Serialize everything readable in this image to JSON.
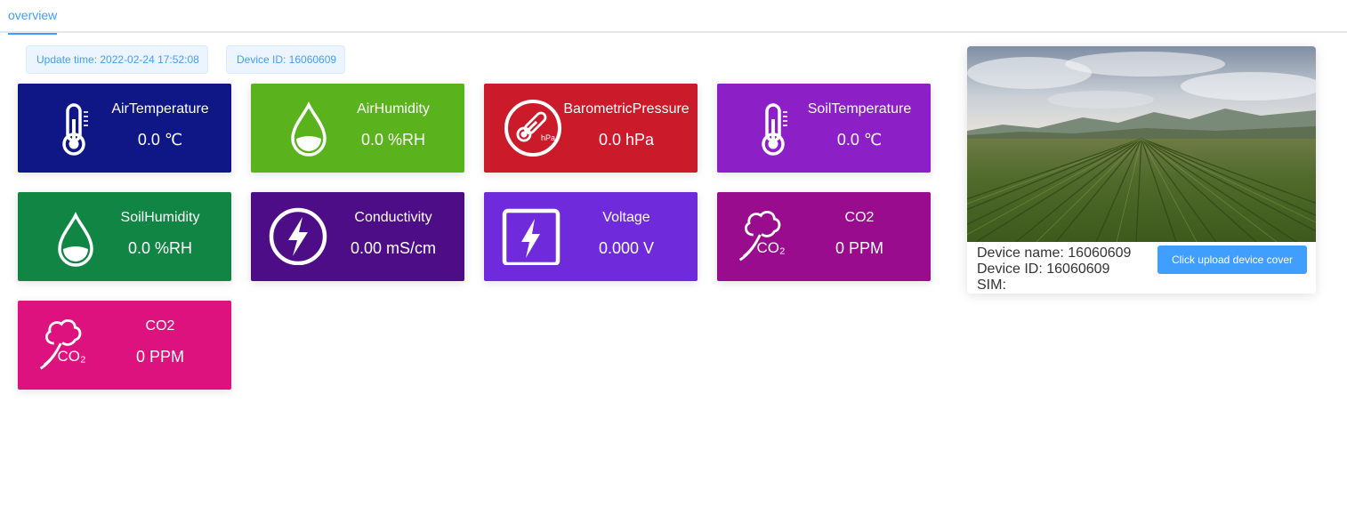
{
  "tabs": {
    "active_label": "overview"
  },
  "header": {
    "update_time": "Update time: 2022-02-24 17:52:08",
    "device_id": "Device ID: 16060609"
  },
  "sensors": [
    {
      "title": "AirTemperature",
      "value": "0.0 ℃",
      "icon": "thermometer-icon",
      "color": "#0f1787"
    },
    {
      "title": "AirHumidity",
      "value": "0.0 %RH",
      "icon": "water-drop-icon",
      "color": "#5ab31c"
    },
    {
      "title": "BarometricPressure",
      "value": "0.0 hPa",
      "icon": "barometer-icon",
      "color": "#cb1b2a",
      "icon_text": "hPa"
    },
    {
      "title": "SoilTemperature",
      "value": "0.0 ℃",
      "icon": "thermometer-icon",
      "color": "#8c1fc6"
    },
    {
      "title": "SoilHumidity",
      "value": "0.0 %RH",
      "icon": "water-drop-icon",
      "color": "#118644"
    },
    {
      "title": "Conductivity",
      "value": "0.00 mS/cm",
      "icon": "lightning-circle-icon",
      "color": "#4d0d86"
    },
    {
      "title": "Voltage",
      "value": "0.000 V",
      "icon": "lightning-square-icon",
      "color": "#6f2bdb"
    },
    {
      "title": "CO2",
      "value": "0 PPM",
      "icon": "co2-cloud-icon",
      "color": "#9a0c8e",
      "icon_text": "CO₂"
    },
    {
      "title": "CO2",
      "value": "0 PPM",
      "icon": "co2-cloud-icon",
      "color": "#de127e",
      "icon_text": "CO₂"
    }
  ],
  "device": {
    "name_line": "Device name: 16060609",
    "id_line": "Device ID: 16060609",
    "sim_line": "SIM:",
    "upload_label": "Click upload device cover",
    "cover_image": "farm-field-photo"
  }
}
